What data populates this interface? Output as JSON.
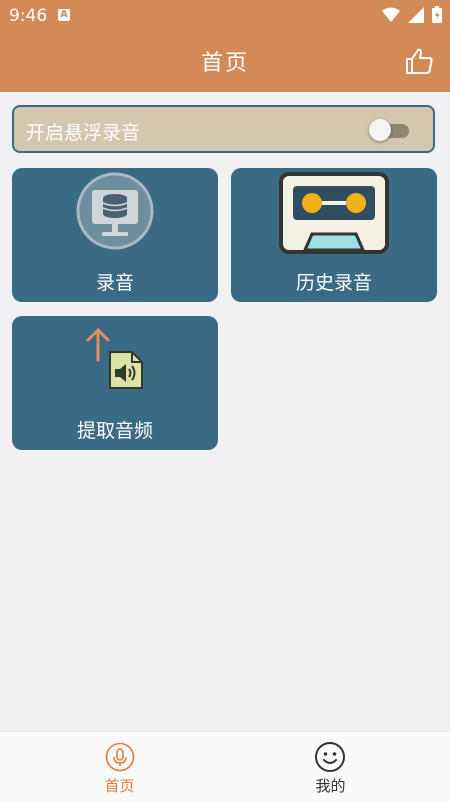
{
  "status_bar": {
    "time": "9:46",
    "notification_icon": "A"
  },
  "header": {
    "title": "首页"
  },
  "float_toggle": {
    "label": "开启悬浮录音",
    "enabled": false
  },
  "cards": [
    {
      "label": "录音",
      "icon": "recorder-icon"
    },
    {
      "label": "历史录音",
      "icon": "cassette-icon"
    },
    {
      "label": "提取音频",
      "icon": "extract-audio-icon"
    }
  ],
  "tabbar": {
    "tabs": [
      {
        "label": "首页",
        "icon": "microphone-icon",
        "active": true
      },
      {
        "label": "我的",
        "icon": "smiley-icon",
        "active": false
      }
    ]
  },
  "colors": {
    "header": "#d28a58",
    "card": "#3b6a84",
    "toggle_bg": "#d3c8ae",
    "tab_active": "#e07a3f",
    "tab_inactive": "#333333"
  }
}
